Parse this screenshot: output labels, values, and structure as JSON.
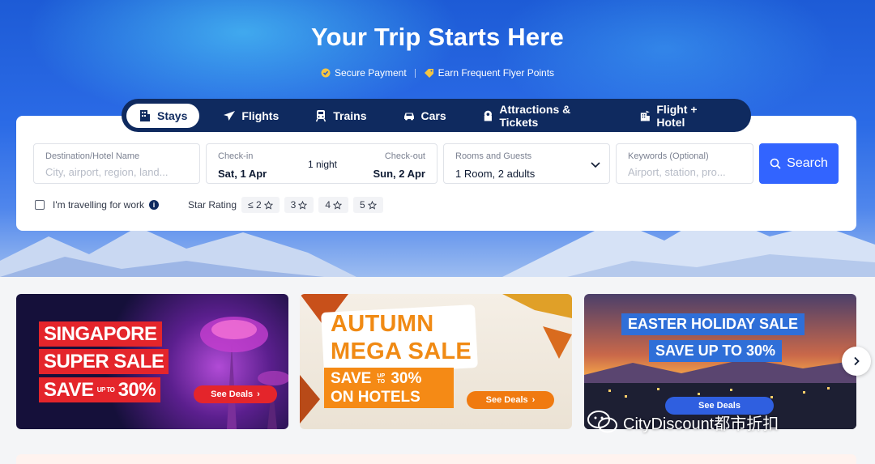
{
  "hero": {
    "title": "Your Trip Starts Here",
    "badges": [
      {
        "label": "Secure Payment",
        "icon": "shield-check-icon"
      },
      {
        "label": "Earn Frequent Flyer Points",
        "icon": "tag-icon"
      }
    ]
  },
  "tabs": [
    {
      "label": "Stays",
      "icon": "hotel-icon",
      "active": true
    },
    {
      "label": "Flights",
      "icon": "plane-icon"
    },
    {
      "label": "Trains",
      "icon": "train-icon"
    },
    {
      "label": "Cars",
      "icon": "car-icon"
    },
    {
      "label": "Attractions & Tickets",
      "icon": "ticket-icon"
    },
    {
      "label": "Flight + Hotel",
      "icon": "flight-hotel-icon"
    }
  ],
  "search": {
    "destination": {
      "label": "Destination/Hotel Name",
      "placeholder": "City, airport, region, land..."
    },
    "dates": {
      "checkin_label": "Check-in",
      "checkin_value": "Sat, 1 Apr",
      "nights": "1 night",
      "checkout_label": "Check-out",
      "checkout_value": "Sun, 2 Apr"
    },
    "rooms": {
      "label": "Rooms and Guests",
      "value": "1 Room, 2 adults"
    },
    "keywords": {
      "label": "Keywords (Optional)",
      "placeholder": "Airport, station, pro..."
    },
    "button_label": "Search",
    "work_travel_label": "I'm travelling for work",
    "star_rating_label": "Star Rating",
    "star_options": [
      "≤ 2",
      "3",
      "4",
      "5"
    ]
  },
  "banners": [
    {
      "lines": [
        "SINGAPORE",
        "SUPER SALE",
        "SAVE",
        "UP TO",
        "30%"
      ],
      "cta": "See Deals"
    },
    {
      "title_lines": [
        "AUTUMN",
        "MEGA SALE"
      ],
      "box_lines": [
        "SAVE",
        "UP TO",
        "30%",
        "ON HOTELS"
      ],
      "cta": "See Deals"
    },
    {
      "lines": [
        "EASTER HOLIDAY SALE",
        "SAVE UP TO 30%"
      ],
      "cta": "See Deals"
    }
  ],
  "watermark": "CityDiscount都市折扣",
  "colors": {
    "primary": "#3264ff",
    "nav_bg": "#0f2a5f",
    "sale_red": "#e4252b",
    "autumn_orange": "#f58a15",
    "easter_blue": "#2f6fd8"
  }
}
